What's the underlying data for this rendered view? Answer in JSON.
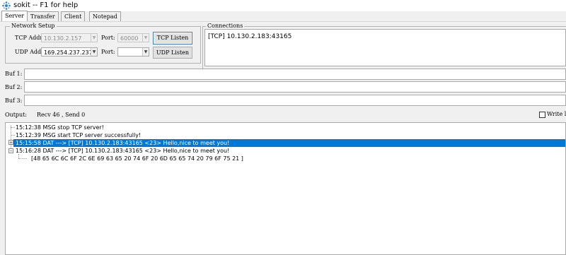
{
  "window": {
    "title": "sokit -- F1 for help",
    "icon": "sokit-app-icon"
  },
  "tabs": [
    {
      "label": "Server",
      "active": true
    },
    {
      "label": "Transfer",
      "active": false
    },
    {
      "label": "Client",
      "active": false
    },
    {
      "label": "Notepad",
      "active": false
    }
  ],
  "network_setup": {
    "legend": "Network Setup",
    "tcp_addr_label": "TCP Addr:",
    "tcp_addr_value": "10.130.2.157",
    "tcp_port_label": "Port:",
    "tcp_port_value": "60000",
    "tcp_listen_button": "TCP Listen",
    "udp_addr_label": "UDP Addr:",
    "udp_addr_value": "169.254.237.237",
    "udp_port_label": "Port:",
    "udp_port_value": "",
    "udp_listen_button": "UDP Listen"
  },
  "connections": {
    "legend": "Connections",
    "items": [
      "[TCP] 10.130.2.183:43165"
    ]
  },
  "buffers": [
    {
      "label": "Buf 1:",
      "value": ""
    },
    {
      "label": "Buf 2:",
      "value": ""
    },
    {
      "label": "Buf 3:",
      "value": ""
    }
  ],
  "output": {
    "label": "Output:",
    "stats": "Recv 46 , Send 0",
    "write_log_label": "Write l",
    "write_log_checked": false,
    "log": [
      {
        "time": "15:12:38",
        "text": "15:12:38 MSG stop TCP server!",
        "expandable": false,
        "selected": false
      },
      {
        "time": "15:12:39",
        "text": "15:12:39 MSG start TCP server successfully!",
        "expandable": false,
        "selected": false
      },
      {
        "time": "15:15:58",
        "text": "15:15:58 DAT ---> [TCP] 10.130.2.183:43165 <23> Hello,nice to meet you!",
        "expandable": true,
        "expanded": false,
        "selected": true
      },
      {
        "time": "15:16:28",
        "text": "15:16:28 DAT ---> [TCP] 10.130.2.183:43165 <23> Hello,nice to meet you!",
        "expandable": true,
        "expanded": true,
        "selected": false,
        "child": "[48 65 6C 6C 6F 2C 6E 69 63 65 20 74 6F 20 6D 65 65 74 20 79 6F 75 21 ]"
      }
    ]
  },
  "colors": {
    "selection": "#0078d7",
    "background": "#f0f0f0",
    "accent_icon": "#2b7de0"
  }
}
